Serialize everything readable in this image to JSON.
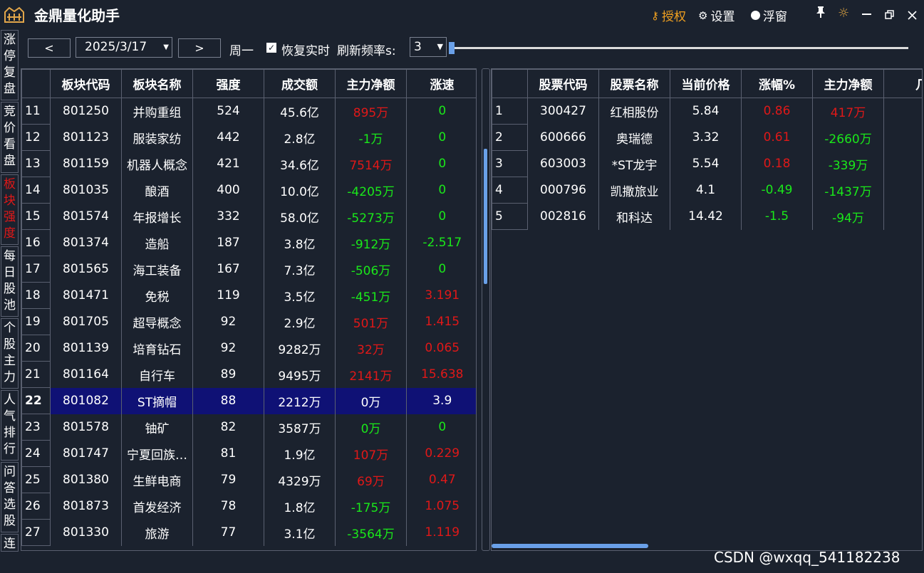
{
  "app": {
    "title": "金鼎量化助手"
  },
  "titlebar": {
    "auth_label": "授权",
    "settings_label": "设置",
    "float_label": "浮窗"
  },
  "colors": {
    "background": "#1b222e",
    "up": "#e01818",
    "down": "#1ae81a",
    "selected_row": "#0f1175",
    "accent": "#6aa0e8",
    "auth": "#f0a020"
  },
  "sidenav": [
    {
      "label": "涨停复盘",
      "active": false
    },
    {
      "label": "竞价看盘",
      "active": false
    },
    {
      "label": "板块强度",
      "active": true
    },
    {
      "label": "每日股池",
      "active": false
    },
    {
      "label": "个股主力",
      "active": false
    },
    {
      "label": "人气排行",
      "active": false
    },
    {
      "label": "问答选股",
      "active": false
    },
    {
      "label": "连",
      "active": false
    }
  ],
  "toolbar": {
    "prev_label": "<",
    "next_label": ">",
    "date_value": "2025/3/17",
    "weekday": "周一",
    "restore_label": "恢复实时",
    "restore_checked": true,
    "rate_label": "刷新频率s:",
    "rate_value": "3"
  },
  "left_table": {
    "columns": [
      "板块代码",
      "板块名称",
      "强度",
      "成交额",
      "主力净额",
      "涨速"
    ],
    "selected_row": 22,
    "rows": [
      {
        "n": "11",
        "code": "801250",
        "name": "并购重组",
        "strength": "524",
        "volume": "45.6亿",
        "net": "895万",
        "net_c": "red",
        "speed": "0",
        "speed_c": "green"
      },
      {
        "n": "12",
        "code": "801123",
        "name": "服装家纺",
        "strength": "442",
        "volume": "2.8亿",
        "net": "-1万",
        "net_c": "green",
        "speed": "0",
        "speed_c": "green"
      },
      {
        "n": "13",
        "code": "801159",
        "name": "机器人概念",
        "strength": "421",
        "volume": "34.6亿",
        "net": "7514万",
        "net_c": "red",
        "speed": "0",
        "speed_c": "green"
      },
      {
        "n": "14",
        "code": "801035",
        "name": "酿酒",
        "strength": "400",
        "volume": "10.0亿",
        "net": "-4205万",
        "net_c": "green",
        "speed": "0",
        "speed_c": "green"
      },
      {
        "n": "15",
        "code": "801574",
        "name": "年报增长",
        "strength": "332",
        "volume": "58.0亿",
        "net": "-5273万",
        "net_c": "green",
        "speed": "0",
        "speed_c": "green"
      },
      {
        "n": "16",
        "code": "801374",
        "name": "造船",
        "strength": "187",
        "volume": "3.8亿",
        "net": "-912万",
        "net_c": "green",
        "speed": "-2.517",
        "speed_c": "green"
      },
      {
        "n": "17",
        "code": "801565",
        "name": "海工装备",
        "strength": "167",
        "volume": "7.3亿",
        "net": "-506万",
        "net_c": "green",
        "speed": "0",
        "speed_c": "green"
      },
      {
        "n": "18",
        "code": "801471",
        "name": "免税",
        "strength": "119",
        "volume": "3.5亿",
        "net": "-451万",
        "net_c": "green",
        "speed": "3.191",
        "speed_c": "red"
      },
      {
        "n": "19",
        "code": "801705",
        "name": "超导概念",
        "strength": "92",
        "volume": "2.9亿",
        "net": "501万",
        "net_c": "red",
        "speed": "1.415",
        "speed_c": "red"
      },
      {
        "n": "20",
        "code": "801139",
        "name": "培育钻石",
        "strength": "92",
        "volume": "9282万",
        "net": "32万",
        "net_c": "red",
        "speed": "0.065",
        "speed_c": "red"
      },
      {
        "n": "21",
        "code": "801164",
        "name": "自行车",
        "strength": "89",
        "volume": "9495万",
        "net": "2141万",
        "net_c": "red",
        "speed": "15.638",
        "speed_c": "red"
      },
      {
        "n": "22",
        "code": "801082",
        "name": "ST摘帽",
        "strength": "88",
        "volume": "2212万",
        "net": "0万",
        "net_c": "white",
        "speed": "3.9",
        "speed_c": "white"
      },
      {
        "n": "23",
        "code": "801578",
        "name": "铀矿",
        "strength": "82",
        "volume": "3587万",
        "net": "0万",
        "net_c": "green",
        "speed": "0",
        "speed_c": "green"
      },
      {
        "n": "24",
        "code": "801747",
        "name": "宁夏回族…",
        "strength": "81",
        "volume": "1.9亿",
        "net": "107万",
        "net_c": "red",
        "speed": "0.229",
        "speed_c": "red"
      },
      {
        "n": "25",
        "code": "801380",
        "name": "生鲜电商",
        "strength": "79",
        "volume": "4329万",
        "net": "69万",
        "net_c": "red",
        "speed": "0.47",
        "speed_c": "red"
      },
      {
        "n": "26",
        "code": "801873",
        "name": "首发经济",
        "strength": "78",
        "volume": "1.8亿",
        "net": "-175万",
        "net_c": "green",
        "speed": "1.075",
        "speed_c": "red"
      },
      {
        "n": "27",
        "code": "801330",
        "name": "旅游",
        "strength": "77",
        "volume": "3.1亿",
        "net": "-3564万",
        "net_c": "green",
        "speed": "1.119",
        "speed_c": "red"
      }
    ]
  },
  "right_table": {
    "columns": [
      "股票代码",
      "股票名称",
      "当前价格",
      "涨幅%",
      "主力净额",
      "几板"
    ],
    "rows": [
      {
        "n": "1",
        "code": "300427",
        "name": "红相股份",
        "price": "5.84",
        "pct": "0.86",
        "pct_c": "red",
        "net": "417万",
        "net_c": "red"
      },
      {
        "n": "2",
        "code": "600666",
        "name": "奥瑞德",
        "price": "3.32",
        "pct": "0.61",
        "pct_c": "red",
        "net": "-2660万",
        "net_c": "green"
      },
      {
        "n": "3",
        "code": "603003",
        "name": "*ST龙宇",
        "price": "5.54",
        "pct": "0.18",
        "pct_c": "red",
        "net": "-339万",
        "net_c": "green"
      },
      {
        "n": "4",
        "code": "000796",
        "name": "凯撒旅业",
        "price": "4.1",
        "pct": "-0.49",
        "pct_c": "green",
        "net": "-1437万",
        "net_c": "green"
      },
      {
        "n": "5",
        "code": "002816",
        "name": "和科达",
        "price": "14.42",
        "pct": "-1.5",
        "pct_c": "green",
        "net": "-94万",
        "net_c": "green"
      }
    ]
  },
  "watermark": "CSDN @wxqq_541182238"
}
